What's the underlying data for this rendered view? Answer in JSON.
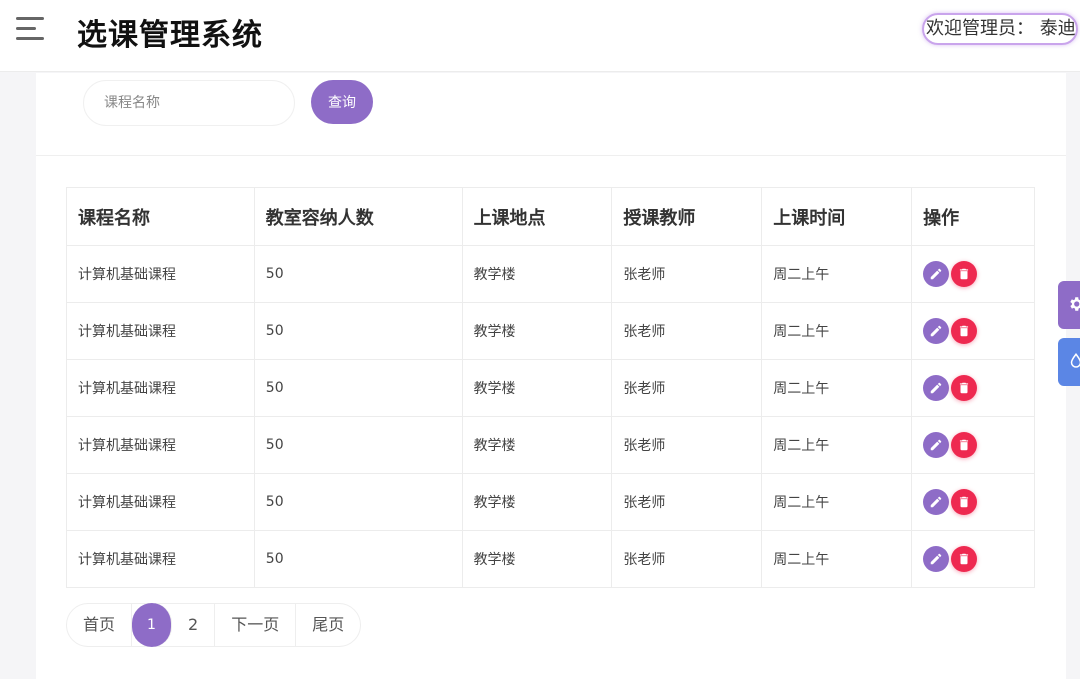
{
  "header": {
    "title": "选课管理系统",
    "welcome": "欢迎管理员：  泰迪"
  },
  "search": {
    "placeholder": "课程名称",
    "button_label": "查询"
  },
  "table": {
    "columns": [
      "课程名称",
      "教室容纳人数",
      "上课地点",
      "授课教师",
      "上课时间",
      "操作"
    ],
    "rows": [
      [
        "计算机基础课程",
        "50",
        "教学楼",
        "张老师",
        "周二上午"
      ],
      [
        "计算机基础课程",
        "50",
        "教学楼",
        "张老师",
        "周二上午"
      ],
      [
        "计算机基础课程",
        "50",
        "教学楼",
        "张老师",
        "周二上午"
      ],
      [
        "计算机基础课程",
        "50",
        "教学楼",
        "张老师",
        "周二上午"
      ],
      [
        "计算机基础课程",
        "50",
        "教学楼",
        "张老师",
        "周二上午"
      ],
      [
        "计算机基础课程",
        "50",
        "教学楼",
        "张老师",
        "周二上午"
      ]
    ]
  },
  "pagination": {
    "first": "首页",
    "pages": [
      "1",
      "2"
    ],
    "active_page": "1",
    "next": "下一页",
    "last": "尾页"
  },
  "icons": {
    "menu": "hamburger-menu-icon",
    "edit": "pencil-icon",
    "delete": "trash-icon",
    "side_tab_1": "gear-icon",
    "side_tab_2": "droplet-icon"
  },
  "colors": {
    "accent": "#8e6cc7",
    "danger": "#ee2950",
    "side_tab_blue": "#5b86e5"
  }
}
